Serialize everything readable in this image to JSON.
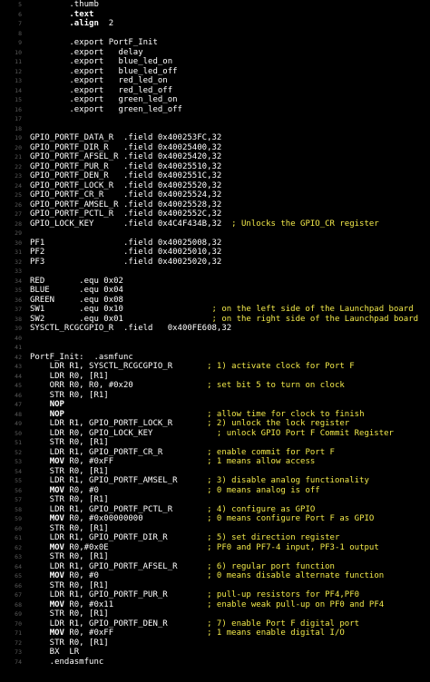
{
  "editor": {
    "colors": {
      "background": "#000000",
      "gutter_text": "#5a5a5a",
      "code_text": "#ffffff",
      "comment_text": "#f2e94a"
    },
    "lines": [
      {
        "number": "5",
        "tokens": [
          {
            "t": "p",
            "text": "        .thumb"
          }
        ]
      },
      {
        "number": "6",
        "tokens": [
          {
            "t": "p",
            "text": "        "
          },
          {
            "t": "k",
            "text": ".text"
          }
        ]
      },
      {
        "number": "7",
        "tokens": [
          {
            "t": "p",
            "text": "        "
          },
          {
            "t": "k",
            "text": ".align"
          },
          {
            "t": "p",
            "text": "  2"
          }
        ]
      },
      {
        "number": "8",
        "tokens": []
      },
      {
        "number": "9",
        "tokens": [
          {
            "t": "p",
            "text": "        .export PortF_Init"
          }
        ]
      },
      {
        "number": "10",
        "tokens": [
          {
            "t": "p",
            "text": "        .export   delay"
          }
        ]
      },
      {
        "number": "11",
        "tokens": [
          {
            "t": "p",
            "text": "        .export   blue_led_on"
          }
        ]
      },
      {
        "number": "12",
        "tokens": [
          {
            "t": "p",
            "text": "        .export   blue_led_off"
          }
        ]
      },
      {
        "number": "13",
        "tokens": [
          {
            "t": "p",
            "text": "        .export   red_led_on"
          }
        ]
      },
      {
        "number": "14",
        "tokens": [
          {
            "t": "p",
            "text": "        .export   red_led_off"
          }
        ]
      },
      {
        "number": "15",
        "tokens": [
          {
            "t": "p",
            "text": "        .export   green_led_on"
          }
        ]
      },
      {
        "number": "16",
        "tokens": [
          {
            "t": "p",
            "text": "        .export   green_led_off"
          }
        ]
      },
      {
        "number": "17",
        "tokens": []
      },
      {
        "number": "18",
        "tokens": []
      },
      {
        "number": "19",
        "tokens": [
          {
            "t": "p",
            "text": "GPIO_PORTF_DATA_R  .field 0x400253FC,32"
          }
        ]
      },
      {
        "number": "20",
        "tokens": [
          {
            "t": "p",
            "text": "GPIO_PORTF_DIR_R   .field 0x40025400,32"
          }
        ]
      },
      {
        "number": "21",
        "tokens": [
          {
            "t": "p",
            "text": "GPIO_PORTF_AFSEL_R .field 0x40025420,32"
          }
        ]
      },
      {
        "number": "22",
        "tokens": [
          {
            "t": "p",
            "text": "GPIO_PORTF_PUR_R   .field 0x40025510,32"
          }
        ]
      },
      {
        "number": "23",
        "tokens": [
          {
            "t": "p",
            "text": "GPIO_PORTF_DEN_R   .field 0x4002551C,32"
          }
        ]
      },
      {
        "number": "24",
        "tokens": [
          {
            "t": "p",
            "text": "GPIO_PORTF_LOCK_R  .field 0x40025520,32"
          }
        ]
      },
      {
        "number": "25",
        "tokens": [
          {
            "t": "p",
            "text": "GPIO_PORTF_CR_R    .field 0x40025524,32"
          }
        ]
      },
      {
        "number": "26",
        "tokens": [
          {
            "t": "p",
            "text": "GPIO_PORTF_AMSEL_R .field 0x40025528,32"
          }
        ]
      },
      {
        "number": "27",
        "tokens": [
          {
            "t": "p",
            "text": "GPIO_PORTF_PCTL_R  .field 0x4002552C,32"
          }
        ]
      },
      {
        "number": "28",
        "tokens": [
          {
            "t": "p",
            "text": "GPIO_LOCK_KEY      .field 0x4C4F434B,32  "
          },
          {
            "t": "c",
            "text": "; Unlocks the GPIO_CR register"
          }
        ]
      },
      {
        "number": "29",
        "tokens": []
      },
      {
        "number": "30",
        "tokens": [
          {
            "t": "p",
            "text": "PF1                .field 0x40025008,32"
          }
        ]
      },
      {
        "number": "31",
        "tokens": [
          {
            "t": "p",
            "text": "PF2                .field 0x40025010,32"
          }
        ]
      },
      {
        "number": "32",
        "tokens": [
          {
            "t": "p",
            "text": "PF3                .field 0x40025020,32"
          }
        ]
      },
      {
        "number": "33",
        "tokens": []
      },
      {
        "number": "34",
        "tokens": [
          {
            "t": "p",
            "text": "RED       .equ 0x02"
          }
        ]
      },
      {
        "number": "35",
        "tokens": [
          {
            "t": "p",
            "text": "BLUE      .equ 0x04"
          }
        ]
      },
      {
        "number": "36",
        "tokens": [
          {
            "t": "p",
            "text": "GREEN     .equ 0x08"
          }
        ]
      },
      {
        "number": "37",
        "tokens": [
          {
            "t": "p",
            "text": "SW1       .equ 0x10                  "
          },
          {
            "t": "c",
            "text": "; on the left side of the Launchpad board"
          }
        ]
      },
      {
        "number": "38",
        "tokens": [
          {
            "t": "p",
            "text": "SW2       .equ 0x01                  "
          },
          {
            "t": "c",
            "text": "; on the right side of the Launchpad board"
          }
        ]
      },
      {
        "number": "39",
        "tokens": [
          {
            "t": "p",
            "text": "SYSCTL_RCGCGPIO_R  .field   0x400FE608,32"
          }
        ]
      },
      {
        "number": "40",
        "tokens": []
      },
      {
        "number": "41",
        "tokens": []
      },
      {
        "number": "42",
        "tokens": [
          {
            "t": "p",
            "text": "PortF_Init:  .asmfunc"
          }
        ]
      },
      {
        "number": "43",
        "tokens": [
          {
            "t": "p",
            "text": "    LDR R1, SYSCTL_RCGCGPIO_R       "
          },
          {
            "t": "c",
            "text": "; 1) activate clock for Port F"
          }
        ]
      },
      {
        "number": "44",
        "tokens": [
          {
            "t": "p",
            "text": "    LDR R0, [R1]"
          }
        ]
      },
      {
        "number": "45",
        "tokens": [
          {
            "t": "p",
            "text": "    ORR R0, R0, #0x20               "
          },
          {
            "t": "c",
            "text": "; set bit 5 to turn on clock"
          }
        ]
      },
      {
        "number": "46",
        "tokens": [
          {
            "t": "p",
            "text": "    STR R0, [R1]"
          }
        ]
      },
      {
        "number": "47",
        "tokens": [
          {
            "t": "p",
            "text": "    "
          },
          {
            "t": "k",
            "text": "NOP"
          }
        ]
      },
      {
        "number": "48",
        "tokens": [
          {
            "t": "p",
            "text": "    "
          },
          {
            "t": "k",
            "text": "NOP"
          },
          {
            "t": "p",
            "text": "                             "
          },
          {
            "t": "c",
            "text": "; allow time for clock to finish"
          }
        ]
      },
      {
        "number": "49",
        "tokens": [
          {
            "t": "p",
            "text": "    LDR R1, GPIO_PORTF_LOCK_R       "
          },
          {
            "t": "c",
            "text": "; 2) unlock the lock register"
          }
        ]
      },
      {
        "number": "50",
        "tokens": [
          {
            "t": "p",
            "text": "    LDR R0, GPIO_LOCK_KEY             "
          },
          {
            "t": "c",
            "text": "; unlock GPIO Port F Commit Register"
          }
        ]
      },
      {
        "number": "51",
        "tokens": [
          {
            "t": "p",
            "text": "    STR R0, [R1]"
          }
        ]
      },
      {
        "number": "52",
        "tokens": [
          {
            "t": "p",
            "text": "    LDR R1, GPIO_PORTF_CR_R         "
          },
          {
            "t": "c",
            "text": "; enable commit for Port F"
          }
        ]
      },
      {
        "number": "53",
        "tokens": [
          {
            "t": "p",
            "text": "    "
          },
          {
            "t": "k",
            "text": "MOV"
          },
          {
            "t": "p",
            "text": " R0, #0xFF                   "
          },
          {
            "t": "c",
            "text": "; 1 means allow access"
          }
        ]
      },
      {
        "number": "54",
        "tokens": [
          {
            "t": "p",
            "text": "    STR R0, [R1]"
          }
        ]
      },
      {
        "number": "55",
        "tokens": [
          {
            "t": "p",
            "text": "    LDR R1, GPIO_PORTF_AMSEL_R      "
          },
          {
            "t": "c",
            "text": "; 3) disable analog functionality"
          }
        ]
      },
      {
        "number": "56",
        "tokens": [
          {
            "t": "p",
            "text": "    "
          },
          {
            "t": "k",
            "text": "MOV"
          },
          {
            "t": "p",
            "text": " R0, #0                      "
          },
          {
            "t": "c",
            "text": "; 0 means analog is off"
          }
        ]
      },
      {
        "number": "57",
        "tokens": [
          {
            "t": "p",
            "text": "    STR R0, [R1]"
          }
        ]
      },
      {
        "number": "58",
        "tokens": [
          {
            "t": "p",
            "text": "    LDR R1, GPIO_PORTF_PCTL_R       "
          },
          {
            "t": "c",
            "text": "; 4) configure as GPIO"
          }
        ]
      },
      {
        "number": "59",
        "tokens": [
          {
            "t": "p",
            "text": "    "
          },
          {
            "t": "k",
            "text": "MOV"
          },
          {
            "t": "p",
            "text": " R0, #0x00000000             "
          },
          {
            "t": "c",
            "text": "; 0 means configure Port F as GPIO"
          }
        ]
      },
      {
        "number": "60",
        "tokens": [
          {
            "t": "p",
            "text": "    STR R0, [R1]"
          }
        ]
      },
      {
        "number": "61",
        "tokens": [
          {
            "t": "p",
            "text": "    LDR R1, GPIO_PORTF_DIR_R        "
          },
          {
            "t": "c",
            "text": "; 5) set direction register"
          }
        ]
      },
      {
        "number": "62",
        "tokens": [
          {
            "t": "p",
            "text": "    "
          },
          {
            "t": "k",
            "text": "MOV"
          },
          {
            "t": "p",
            "text": " R0,#0x0E                    "
          },
          {
            "t": "c",
            "text": "; PF0 and PF7-4 input, PF3-1 output"
          }
        ]
      },
      {
        "number": "63",
        "tokens": [
          {
            "t": "p",
            "text": "    STR R0, [R1]"
          }
        ]
      },
      {
        "number": "64",
        "tokens": [
          {
            "t": "p",
            "text": "    LDR R1, GPIO_PORTF_AFSEL_R      "
          },
          {
            "t": "c",
            "text": "; 6) regular port function"
          }
        ]
      },
      {
        "number": "65",
        "tokens": [
          {
            "t": "p",
            "text": "    "
          },
          {
            "t": "k",
            "text": "MOV"
          },
          {
            "t": "p",
            "text": " R0, #0                      "
          },
          {
            "t": "c",
            "text": "; 0 means disable alternate function"
          }
        ]
      },
      {
        "number": "66",
        "tokens": [
          {
            "t": "p",
            "text": "    STR R0, [R1]"
          }
        ]
      },
      {
        "number": "67",
        "tokens": [
          {
            "t": "p",
            "text": "    LDR R1, GPIO_PORTF_PUR_R        "
          },
          {
            "t": "c",
            "text": "; pull-up resistors for PF4,PF0"
          }
        ]
      },
      {
        "number": "68",
        "tokens": [
          {
            "t": "p",
            "text": "    "
          },
          {
            "t": "k",
            "text": "MOV"
          },
          {
            "t": "p",
            "text": " R0, #0x11                   "
          },
          {
            "t": "c",
            "text": "; enable weak pull-up on PF0 and PF4"
          }
        ]
      },
      {
        "number": "69",
        "tokens": [
          {
            "t": "p",
            "text": "    STR R0, [R1]"
          }
        ]
      },
      {
        "number": "70",
        "tokens": [
          {
            "t": "p",
            "text": "    LDR R1, GPIO_PORTF_DEN_R        "
          },
          {
            "t": "c",
            "text": "; 7) enable Port F digital port"
          }
        ]
      },
      {
        "number": "71",
        "tokens": [
          {
            "t": "p",
            "text": "    "
          },
          {
            "t": "k",
            "text": "MOV"
          },
          {
            "t": "p",
            "text": " R0, #0xFF                   "
          },
          {
            "t": "c",
            "text": "; 1 means enable digital I/O"
          }
        ]
      },
      {
        "number": "72",
        "tokens": [
          {
            "t": "p",
            "text": "    STR R0, [R1]"
          }
        ]
      },
      {
        "number": "73",
        "tokens": [
          {
            "t": "p",
            "text": "    BX  LR"
          }
        ]
      },
      {
        "number": "74",
        "tokens": [
          {
            "t": "p",
            "text": "    .endasmfunc"
          }
        ]
      }
    ]
  }
}
